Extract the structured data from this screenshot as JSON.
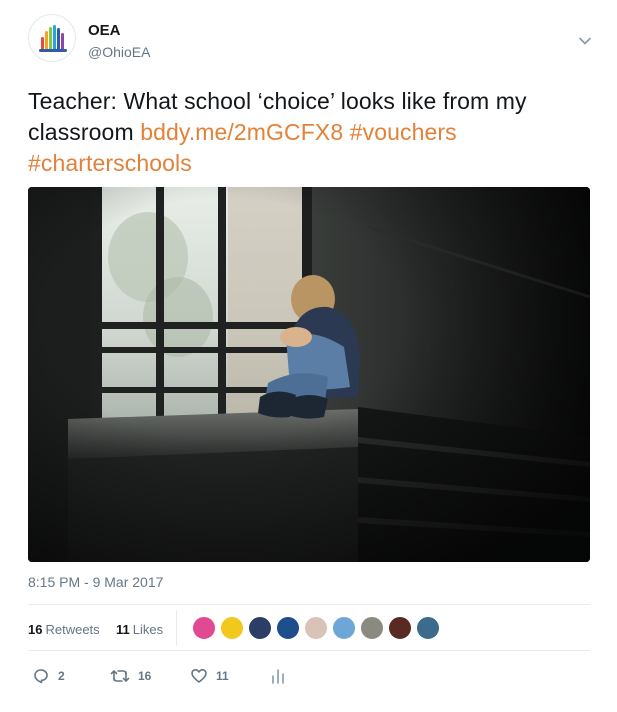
{
  "account": {
    "name": "OEA",
    "handle": "@OhioEA"
  },
  "tweet": {
    "text_main": "Teacher: What school ‘choice’ looks like from my classroom ",
    "link": "bddy.me/2mGCFX8",
    "hashtag1": "#vouchers",
    "hashtag2": "#charterschools",
    "timestamp": "8:15 PM - 9 Mar 2017"
  },
  "stats": {
    "retweets_count": "16",
    "retweets_label": "Retweets",
    "likes_count": "11",
    "likes_label": "Likes"
  },
  "actions": {
    "reply_count": "2",
    "retweet_count": "16",
    "like_count": "11"
  },
  "colors": {
    "link": "#e2813a",
    "secondary_text": "#657786"
  },
  "icons": [
    "oea-logo",
    "chevron-down-icon",
    "reply-icon",
    "retweet-icon",
    "heart-icon",
    "analytics-icon"
  ]
}
